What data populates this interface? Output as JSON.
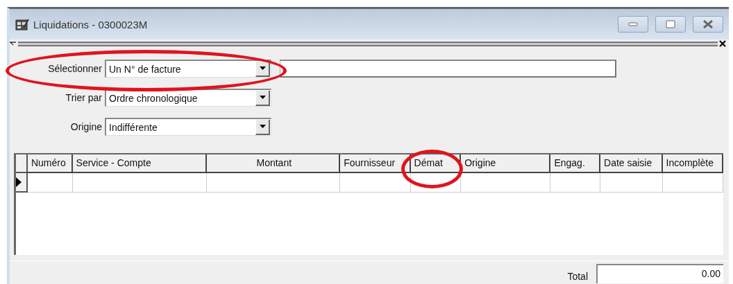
{
  "window": {
    "title": "Liquidations - 0300023M"
  },
  "filters": [
    {
      "label": "Sélectionner",
      "value": "Un N° de facture",
      "highlighted": true,
      "has_text_field": true
    },
    {
      "label": "Trier par",
      "value": "Ordre chronologique",
      "highlighted": false,
      "has_text_field": false
    },
    {
      "label": "Origine",
      "value": "Indifférente",
      "highlighted": false,
      "has_text_field": false
    }
  ],
  "table": {
    "columns": [
      {
        "label": "Numéro",
        "highlighted": false
      },
      {
        "label": "Service - Compte",
        "highlighted": false
      },
      {
        "label": "Montant",
        "highlighted": false
      },
      {
        "label": "Fournisseur",
        "highlighted": false
      },
      {
        "label": "Démat",
        "highlighted": true
      },
      {
        "label": "Origine",
        "highlighted": false
      },
      {
        "label": "Engag.",
        "highlighted": false
      },
      {
        "label": "Date saisie",
        "highlighted": false
      },
      {
        "label": "Incomplète",
        "highlighted": false
      }
    ]
  },
  "total": {
    "label": "Total",
    "value": "0.00"
  }
}
